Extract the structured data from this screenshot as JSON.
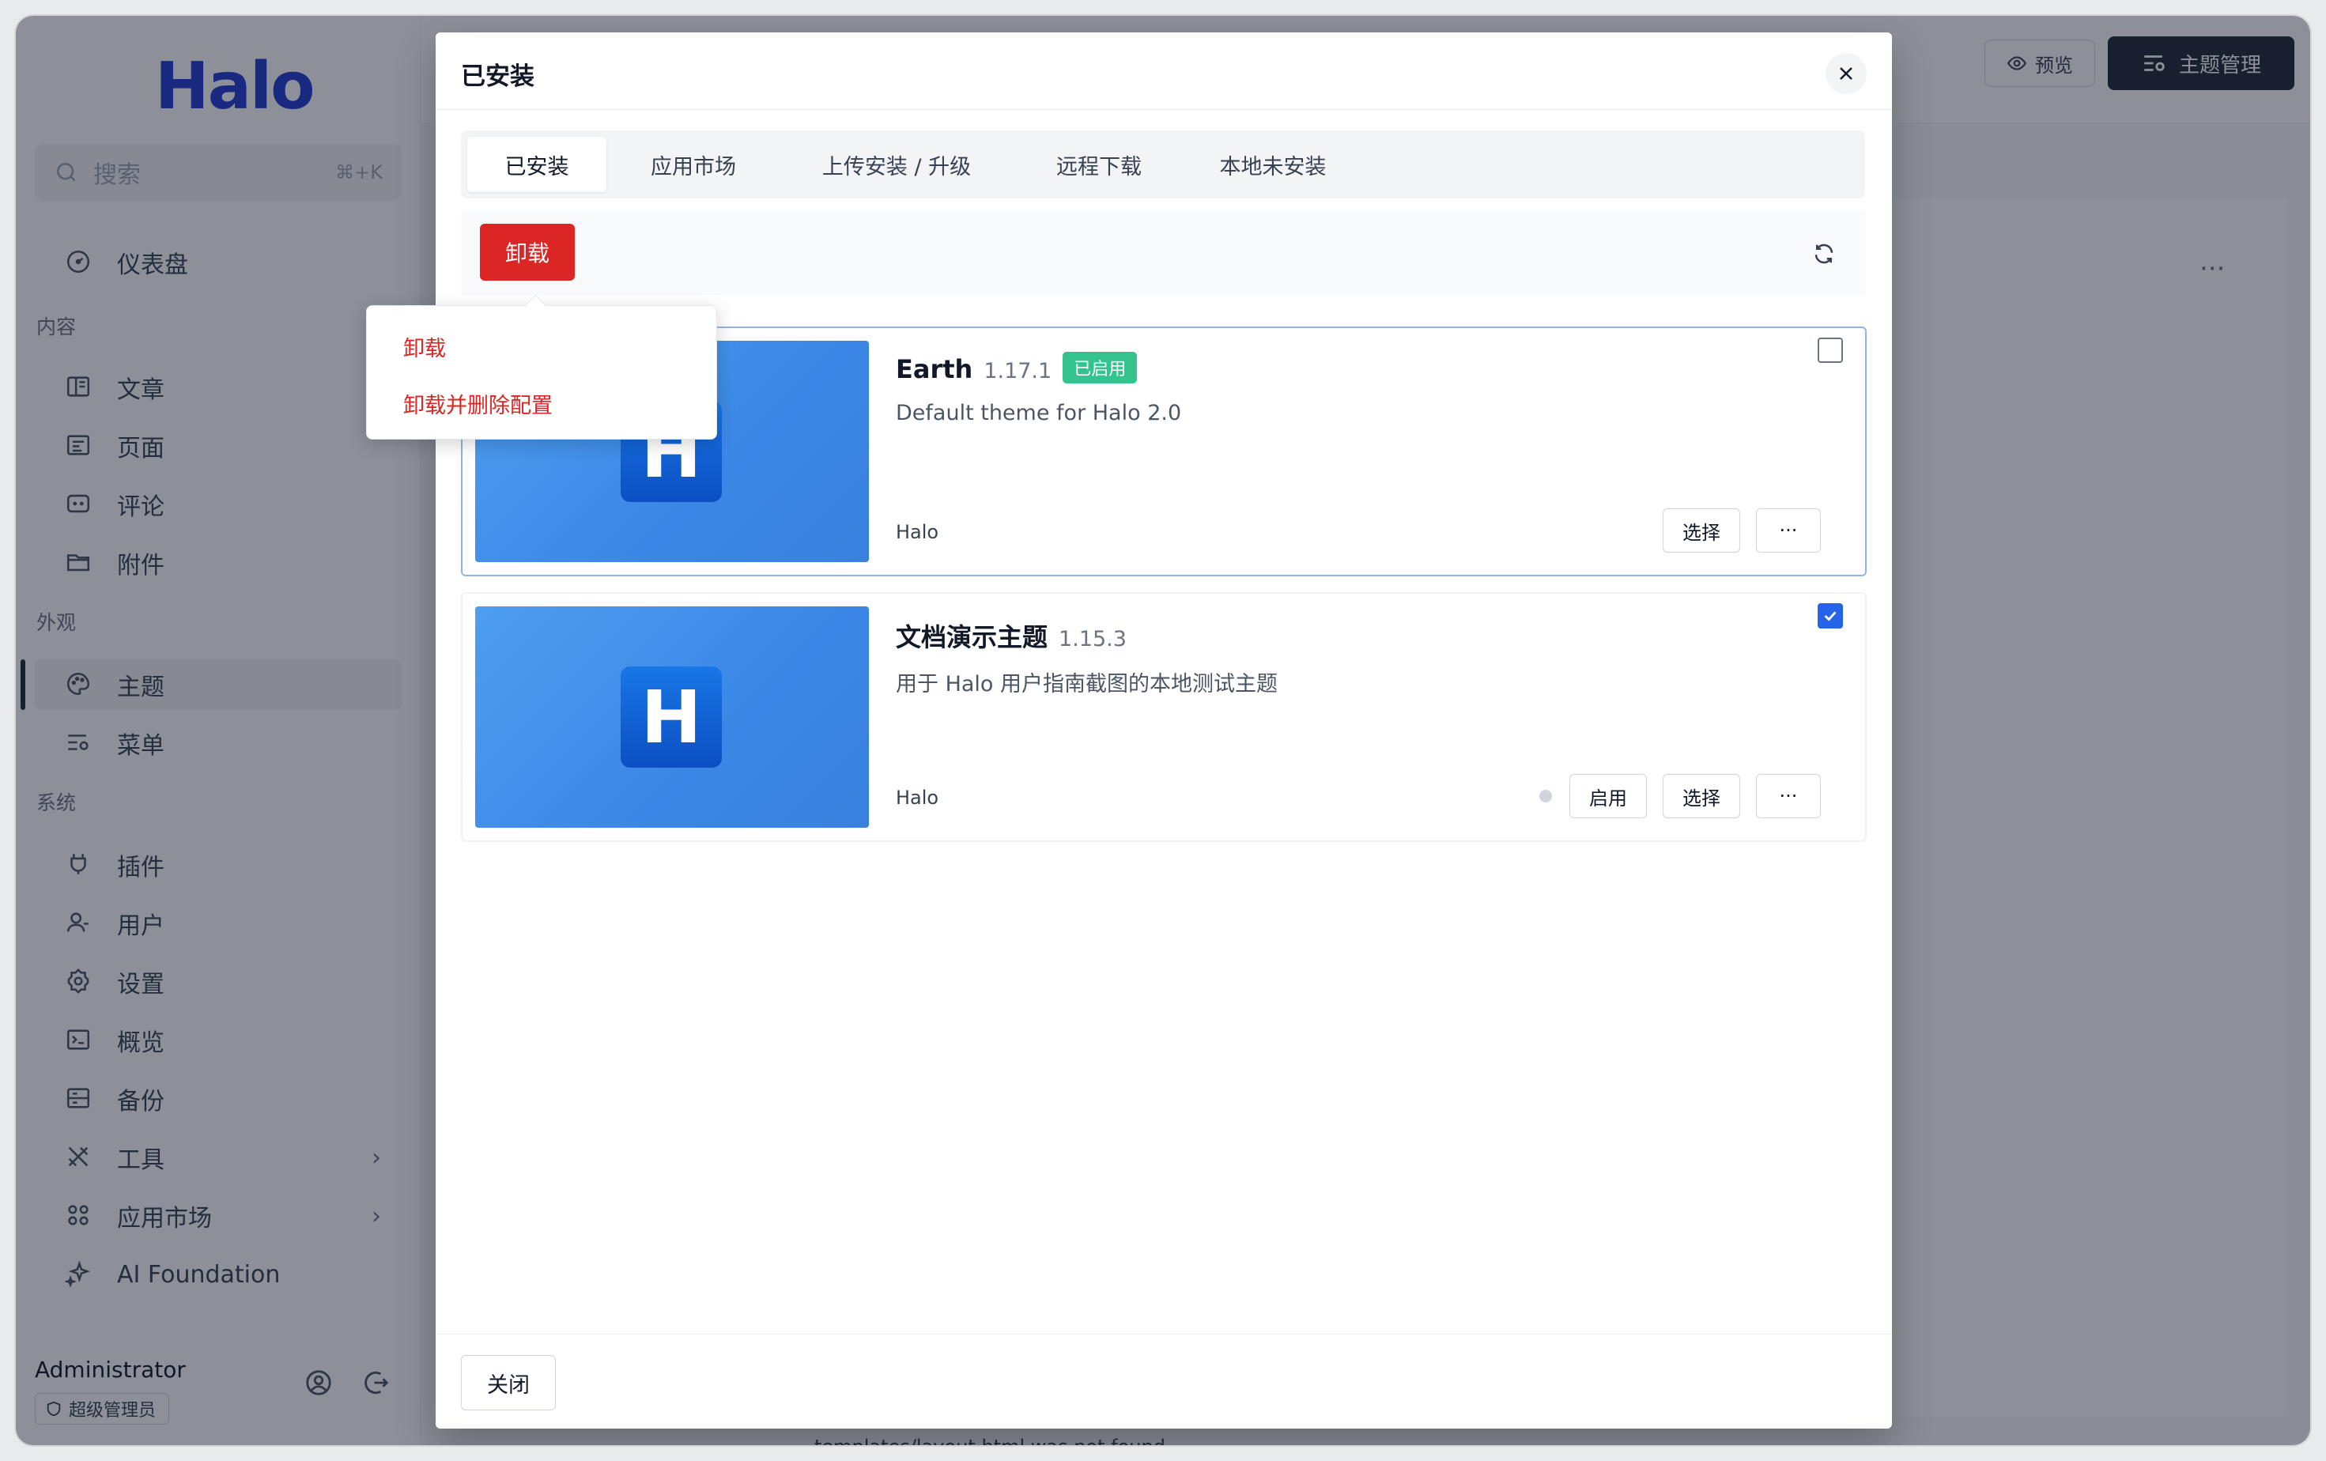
{
  "colors": {
    "accent": "#1f3bd0",
    "danger": "#dc2626",
    "success": "#34c38f",
    "checkbox": "#2563eb"
  },
  "sidebar": {
    "logo": "Halo",
    "search": {
      "placeholder": "搜索",
      "shortcut": "⌘+K"
    },
    "items": [
      {
        "label": "仪表盘",
        "icon": "dashboard-icon"
      },
      {
        "group": "内容"
      },
      {
        "label": "文章",
        "icon": "book-icon"
      },
      {
        "label": "页面",
        "icon": "page-icon"
      },
      {
        "label": "评论",
        "icon": "comment-icon"
      },
      {
        "label": "附件",
        "icon": "folder-icon"
      },
      {
        "group": "外观"
      },
      {
        "label": "主题",
        "icon": "palette-icon",
        "active": true
      },
      {
        "label": "菜单",
        "icon": "menu-icon"
      },
      {
        "group": "系统"
      },
      {
        "label": "插件",
        "icon": "plugin-icon"
      },
      {
        "label": "用户",
        "icon": "user-icon"
      },
      {
        "label": "设置",
        "icon": "settings-icon"
      },
      {
        "label": "概览",
        "icon": "terminal-icon"
      },
      {
        "label": "备份",
        "icon": "backup-icon"
      },
      {
        "label": "工具",
        "icon": "tools-icon",
        "expandable": true
      },
      {
        "label": "应用市场",
        "icon": "apps-icon",
        "expandable": true
      },
      {
        "label": "AI Foundation",
        "icon": "sparkle-icon"
      }
    ],
    "user": {
      "name": "Administrator",
      "role": "超级管理员"
    }
  },
  "header": {
    "preview_label": "预览",
    "theme_mgmt_label": "主题管理"
  },
  "background": {
    "footer_text": "templates/layout.html was not found."
  },
  "modal": {
    "title": "已安装",
    "tabs": [
      "已安装",
      "应用市场",
      "上传安装 / 升级",
      "远程下载",
      "本地未安装"
    ],
    "active_tab": 0,
    "uninstall_label": "卸载",
    "dropdown": [
      "卸载",
      "卸载并删除配置"
    ],
    "themes": [
      {
        "name": "Earth",
        "version": "1.17.1",
        "badge": "已启用",
        "description": "Default theme for Halo 2.0",
        "author": "Halo",
        "checked": false,
        "buttons": [
          "选择",
          "···"
        ]
      },
      {
        "name": "文档演示主题",
        "version": "1.15.3",
        "badge": "",
        "description": "用于 Halo 用户指南截图的本地测试主题",
        "author": "Halo",
        "checked": true,
        "buttons": [
          "启用",
          "选择",
          "···"
        ]
      }
    ],
    "close_label": "关闭"
  }
}
